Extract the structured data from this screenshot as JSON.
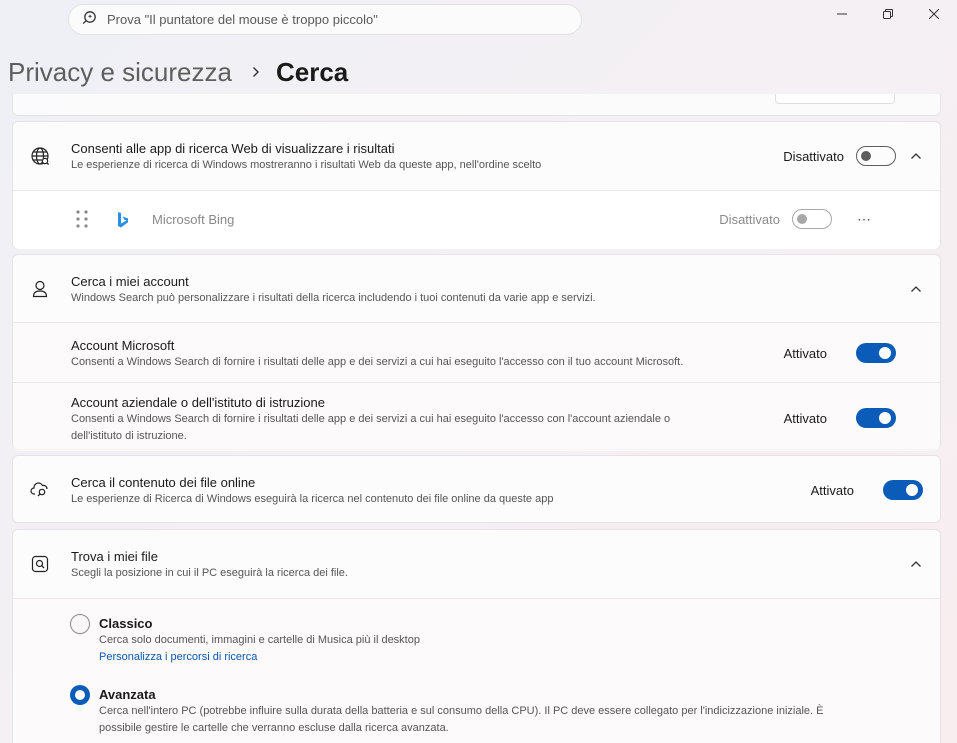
{
  "titlebar": {
    "search_placeholder": "Prova \"Il puntatore del mouse è troppo piccolo\""
  },
  "breadcrumb": {
    "parent": "Privacy e sicurezza",
    "current": "Cerca"
  },
  "web_search": {
    "title": "Consenti alle app di ricerca Web di visualizzare i risultati",
    "description": "Le esperienze di ricerca di Windows mostreranno i risultati Web da queste app, nell'ordine scelto",
    "state": "Disattivato",
    "app": {
      "name": "Microsoft Bing",
      "state": "Disattivato"
    }
  },
  "accounts": {
    "title": "Cerca i miei account",
    "description": "Windows Search può personalizzare i risultati della ricerca includendo i tuoi contenuti da varie app e servizi.",
    "items": [
      {
        "title": "Account Microsoft",
        "description": "Consenti a Windows Search di fornire i risultati delle app e dei servizi a cui hai eseguito l'accesso con il tuo account Microsoft.",
        "state": "Attivato"
      },
      {
        "title": "Account aziendale o dell'istituto di istruzione",
        "description_line1": "Consenti a Windows Search di fornire i risultati delle app e dei servizi a cui hai eseguito l'accesso con l'account aziendale o",
        "description_line2": "dell'istituto di istruzione.",
        "state": "Attivato"
      }
    ]
  },
  "online_files": {
    "title": "Cerca il contenuto dei file online",
    "description": "Le esperienze di Ricerca di Windows eseguirà la ricerca nel contenuto dei file online da queste app",
    "state": "Attivato"
  },
  "find_files": {
    "title": "Trova i miei file",
    "description": "Scegli la posizione in cui il PC eseguirà la ricerca dei file.",
    "options": [
      {
        "title": "Classico",
        "description": "Cerca solo documenti, immagini e cartelle di Musica più il desktop",
        "link": "Personalizza i percorsi di ricerca",
        "selected": false
      },
      {
        "title": "Avanzata",
        "description_line1": "Cerca nell'intero PC (potrebbe influire sulla durata della batteria e sul consumo della CPU). Il PC deve essere collegato per l'indicizzazione iniziale. È",
        "description_line2": "possibile gestire le cartelle che verranno escluse dalla ricerca avanzata.",
        "selected": true
      }
    ]
  },
  "colors": {
    "accent": "#0a5cb8",
    "link": "#0b56ad"
  }
}
